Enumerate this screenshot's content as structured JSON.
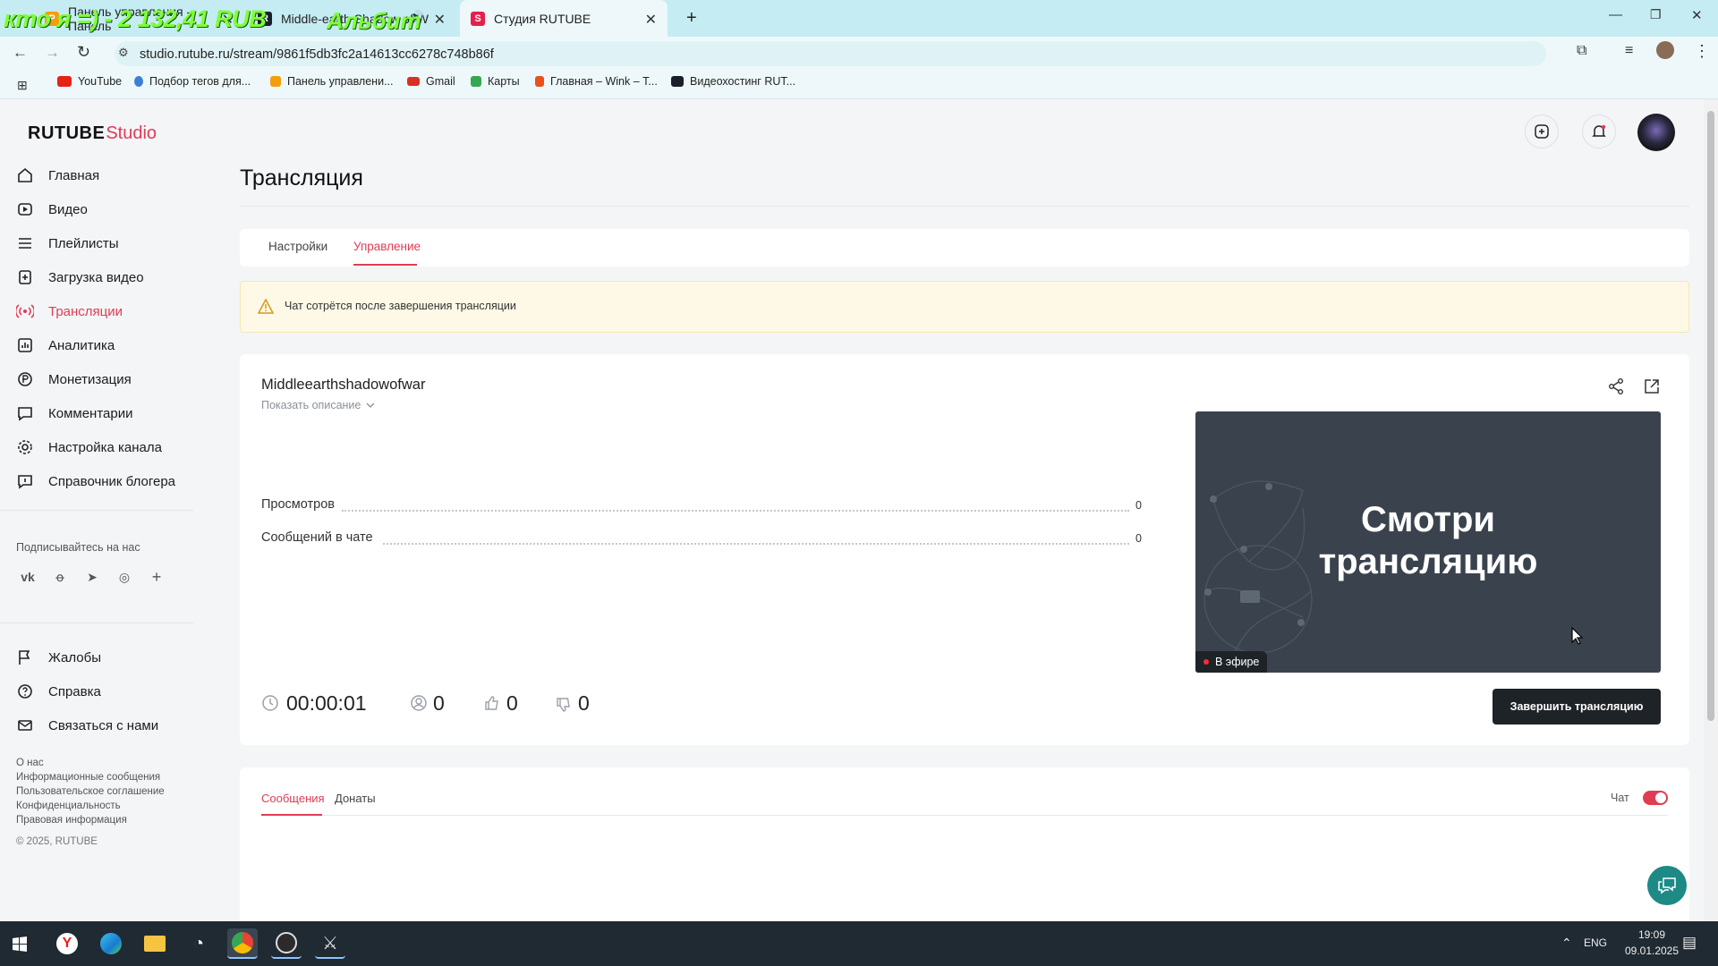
{
  "browser": {
    "tabs": [
      {
        "title": "Панель управления - Панель",
        "favicon_color": "#f59d0b"
      },
      {
        "title": "Middle-earth Shadow of W",
        "favicon_color": "#1b1f2b"
      },
      {
        "title": "Студия RUTUBE",
        "favicon_color": "#e6204e"
      }
    ],
    "overlay_text": "кто я =) - 2 132,41 RUB",
    "overlay_text2": "Альбит",
    "url": "studio.rutube.ru/stream/9861f5db3fc2a14613cc6278c748b86f",
    "bookmarks": [
      "YouTube",
      "Подбор тегов для...",
      "Панель управлени...",
      "Gmail",
      "Карты",
      "Главная – Wink – Т...",
      "Видеохостинг RUT..."
    ]
  },
  "logo": {
    "main": "RUTUBE",
    "sub": "Studio"
  },
  "sidebar": {
    "items": [
      {
        "label": "Главная",
        "icon": "home-icon"
      },
      {
        "label": "Видео",
        "icon": "video-icon"
      },
      {
        "label": "Плейлисты",
        "icon": "playlist-icon"
      },
      {
        "label": "Загрузка видео",
        "icon": "upload-icon"
      },
      {
        "label": "Трансляции",
        "icon": "broadcast-icon"
      },
      {
        "label": "Аналитика",
        "icon": "analytics-icon"
      },
      {
        "label": "Монетизация",
        "icon": "monetization-icon"
      },
      {
        "label": "Комментарии",
        "icon": "comments-icon"
      },
      {
        "label": "Настройка канала",
        "icon": "settings-icon"
      },
      {
        "label": "Справочник блогера",
        "icon": "info-icon"
      }
    ],
    "subscribe_label": "Подписывайтесь на нас",
    "bottom_items": [
      {
        "label": "Жалобы",
        "icon": "flag-icon"
      },
      {
        "label": "Справка",
        "icon": "help-icon"
      },
      {
        "label": "Связаться с нами",
        "icon": "mail-icon"
      }
    ],
    "footer_links": [
      "О нас",
      "Информационные сообщения",
      "Пользовательское соглашение",
      "Конфиденциальность",
      "Правовая информация"
    ],
    "copyright": "© 2025, RUTUBE"
  },
  "page": {
    "title": "Трансляция",
    "tabs": [
      {
        "label": "Настройки"
      },
      {
        "label": "Управление"
      }
    ],
    "active_tab": "Управление",
    "warning": "Чат сотрётся после завершения трансляции"
  },
  "stream": {
    "name": "Middleearthshadowofwar",
    "show_description": "Показать описание",
    "stats": [
      {
        "label": "Просмотров",
        "value": "0"
      },
      {
        "label": "Сообщений в чате",
        "value": "0"
      }
    ],
    "timer": "00:00:01",
    "viewers": "0",
    "likes": "0",
    "dislikes": "0",
    "preview_line1": "Смотри",
    "preview_line2": "трансляцию",
    "live_badge": "В эфире",
    "end_button": "Завершить трансляцию"
  },
  "chat": {
    "tabs": [
      {
        "label": "Сообщения"
      },
      {
        "label": "Донаты"
      }
    ],
    "toggle_label": "Чат",
    "toggle_on": true
  },
  "taskbar": {
    "lang": "ENG",
    "time": "19:09",
    "date": "09.01.2025"
  },
  "colors": {
    "accent": "#e03c54",
    "preview_bg": "#3a434d",
    "end_button_bg": "#1e2328",
    "warning_bg": "#fdf9e6"
  }
}
